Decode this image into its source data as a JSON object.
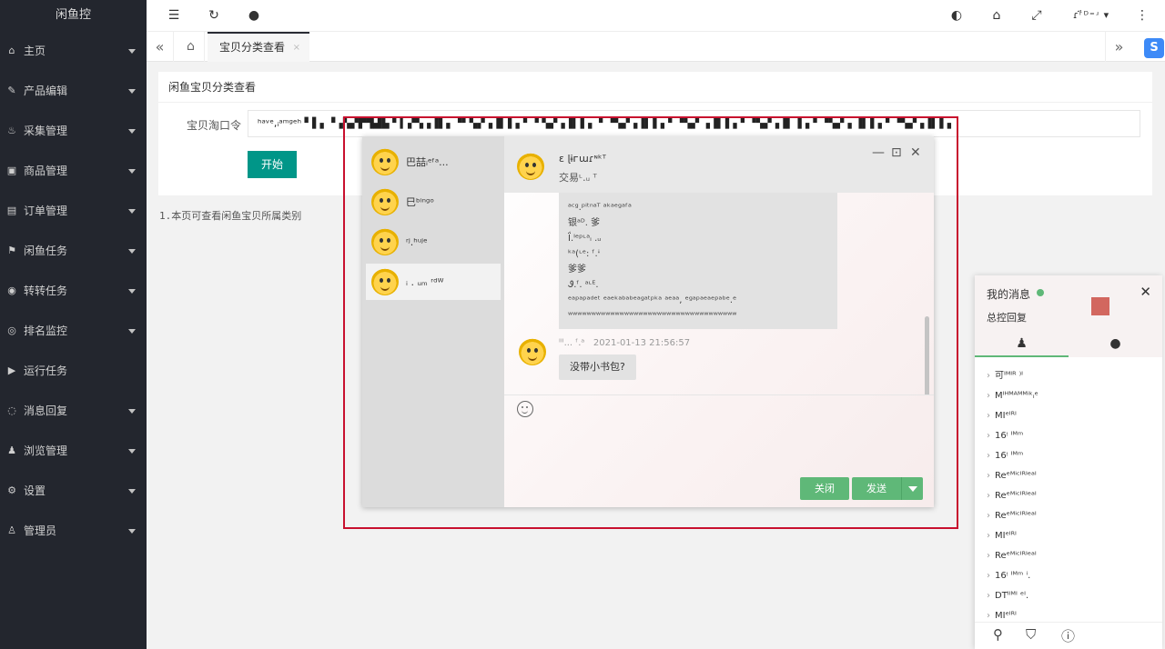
{
  "sidebar": {
    "brand": "闲鱼控",
    "items": [
      {
        "label": "主页",
        "icon": "⌂"
      },
      {
        "label": "产品编辑",
        "icon": "✎"
      },
      {
        "label": "采集管理",
        "icon": "♨"
      },
      {
        "label": "商品管理",
        "icon": "▣"
      },
      {
        "label": "订单管理",
        "icon": "▤"
      },
      {
        "label": "闲鱼任务",
        "icon": "⚑"
      },
      {
        "label": "转转任务",
        "icon": "◉"
      },
      {
        "label": "排名监控",
        "icon": "◎"
      },
      {
        "label": "运行任务",
        "icon": "▶"
      },
      {
        "label": "消息回复",
        "icon": "◌"
      },
      {
        "label": "浏览管理",
        "icon": "♟"
      },
      {
        "label": "设置",
        "icon": "⚙"
      },
      {
        "label": "管理员",
        "icon": "♙"
      }
    ]
  },
  "header": {
    "user": "ɾʳ፟ᴰ⁼ʴ ▾"
  },
  "tabs": {
    "active_label": "宝贝分类查看",
    "close": "×"
  },
  "card": {
    "title": "闲鱼宝贝分类查看",
    "field_label": "宝贝淘口令",
    "field_value": "ʰᵃᵛᵉ,ᵢᵃᵐᵍᵉʰ ▘▌▖▝▗▚▞▛▜▟▙ ▘▍▞▚▗▐▌▖▝▘▚▞▗▐▍▌▖▘▝ ▚▞▗▐▍▌▖ ▘▝▚▞▗▐▍▌▖▘▝▚▞ ▗▐▍▌▖▘▝▚▞▗▐▍ ▌▖▘▝▚▞▗ ▐▍▌▖▘▝▚▞▗▐▍▌▖",
    "start_button": "开始"
  },
  "note": "1.本页可查看闲鱼宝贝所属类别",
  "chat": {
    "contacts": [
      {
        "name": "巴喆ᵢᵉᶠᵃ..."
      },
      {
        "name": "巳ᵇⁱⁿᵍᵒ"
      },
      {
        "name": "ʳʲ.ʰᵘʲᵉ"
      },
      {
        "name": "ᵢ . ᵤₘ ʳᵈᵂ"
      }
    ],
    "head_name": "ɛ ɭɨᴦɯɾᶰᵏᵀ",
    "head_sub": "交易ᶫ.ᵤ ᵀ",
    "message_lines": [
      "ᵃᶜᵍ.ᵖⁱᵗⁿᵃᵀ ᵃᵏᵃᵉᵍᵃᶠᵃ",
      "银ᵃᴰ. 爹",
      "Ḯ.ᴵᵉᵖᶫᵃᵢ .ᵤ",
      "ᵏᵃ(ᶫᵉ: ᶠ.ᶤ",
      "爹爹",
      "Ꮽ.ᶠ. ᵃᶫᴱ.",
      "ᵉᵃᵖᵃᵖᵃᵈᵉᵗ ᵉᵃᵉᵏᵃᵇᵃᵇᵉᵃᵍᵃᵗᵖᵏᵃ ᵃᵉᵃᵃ, ᵉᵍᵃᵖᵃᵉᵃᵉᵖᵃᵇᵉ.ᵉ",
      "ʷʷʷʷʷʷʷʷʷʷʷʷʷʷʷʷʷʷʷʷʷʷʷʷʷʷʷʷʷʷʷʷʷʷʷʷ"
    ],
    "msg2_sender": "ᴵᴵᴵ... ᶠ.ᵃ",
    "msg2_time": "2021-01-13 21:56:57",
    "msg2_text": "没带小书包?",
    "close_button": "关闭",
    "send_button": "发送",
    "minimize": "—",
    "maximize": "⊡",
    "close_x": "✕"
  },
  "msgpanel": {
    "title": "我的消息",
    "subtitle": "总控回复",
    "close": "✕",
    "tab_contacts_icon": "♟",
    "tab_chat_icon": "●",
    "items": [
      "可ᴵᴹᴵᴿ ⁾ᴵ",
      "Mᴵᴴᴹᴬᴹᴹⁱᵏᵢᵉ",
      "MIᵉᴵᴿᴵ",
      "16ᵎ ᴵᴹᵐ",
      "16ᵎ ᴵᴹᵐ",
      "Reᵉᴹⁱᶜᴵᴿᴵᵉᵃᴵ",
      "Reᵉᴹⁱᶜᴵᴿᴵᵉᵃᴵ",
      "Reᵉᴹⁱᶜᴵᴿᴵᵉᵃᴵ",
      "MIᵉᴵᴿᴵ",
      "Reᵉᴹⁱᶜᴵᴿᴵᵉᵃᴵ",
      "16ᵎ ᴵᴹᵐ ⁱ.",
      "DTᴵᴵᴹᴵ ᵉᴵ.",
      "MIᵉᴵᴿᴵ"
    ],
    "foot_search": "⚲",
    "foot_skin": "⛉",
    "foot_info": "ⓘ"
  }
}
